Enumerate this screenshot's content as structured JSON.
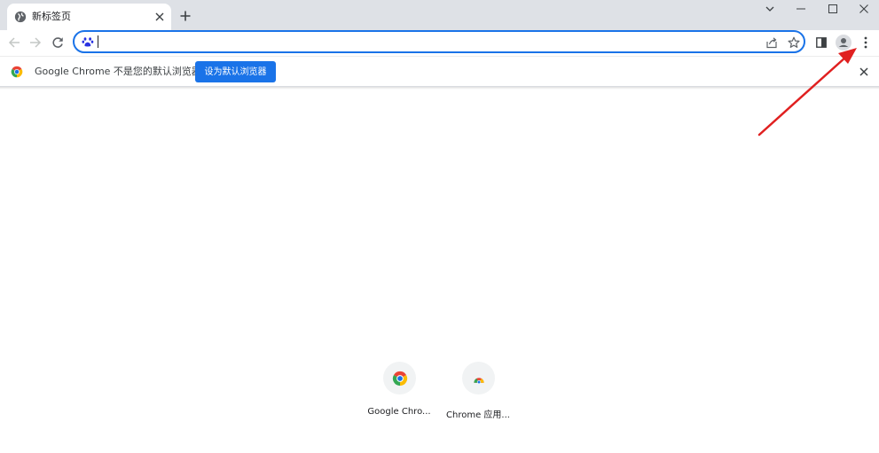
{
  "tab": {
    "title": "新标签页"
  },
  "omnibox": {
    "value": "",
    "placeholder": ""
  },
  "infobar": {
    "message": "Google Chrome 不是您的默认浏览器",
    "button_label": "设为默认浏览器"
  },
  "shortcuts": [
    {
      "label": "Google Chro..."
    },
    {
      "label": "Chrome 应用..."
    }
  ],
  "colors": {
    "accent": "#1a73e8",
    "tabstrip": "#dee1e6",
    "annotation_arrow": "#e02020"
  },
  "icons": {
    "tab_favicon": "globe-icon",
    "tab_close": "close-icon",
    "new_tab": "plus-icon",
    "window_chevron": "chevron-down-icon",
    "minimize": "minimize-icon",
    "maximize": "maximize-icon",
    "window_close": "close-icon",
    "back": "arrow-left-icon",
    "forward": "arrow-right-icon",
    "reload": "reload-icon",
    "search_engine": "baidu-paw-icon",
    "share": "share-icon",
    "bookmark": "star-icon",
    "side_panel": "side-panel-icon",
    "profile": "profile-icon",
    "menu": "kebab-menu-icon",
    "chrome_logo": "chrome-logo-icon"
  }
}
